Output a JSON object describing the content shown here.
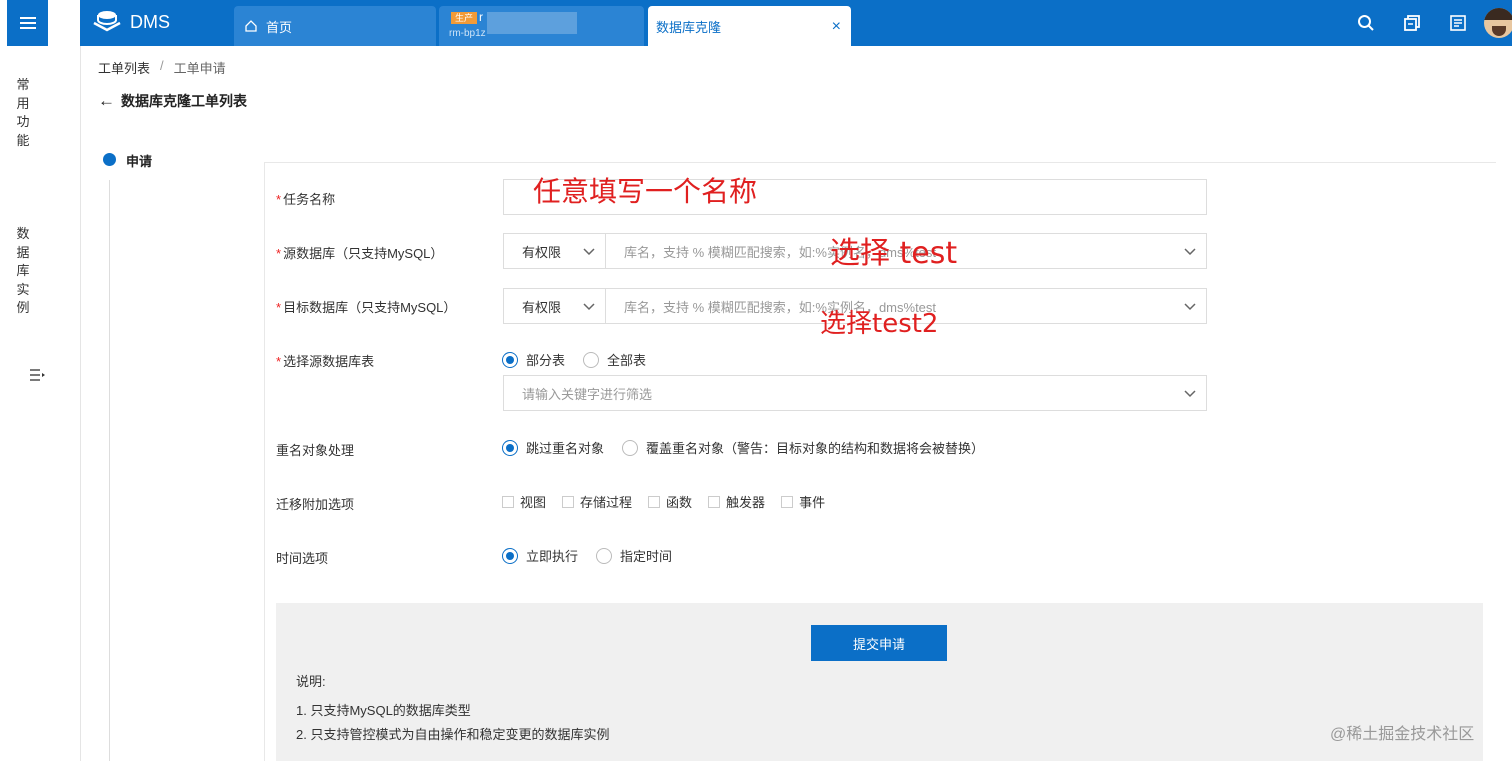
{
  "topbar": {
    "brand": "DMS",
    "tabs": [
      {
        "label": "首页"
      },
      {
        "env": "生产",
        "title": "r",
        "sub": "rm-bp1z"
      },
      {
        "label": "数据库克隆",
        "close": "×"
      }
    ]
  },
  "rail": {
    "common": "常用功能",
    "instances": "数据库实例"
  },
  "breadcrumb": {
    "first": "工单列表",
    "sep": "/",
    "current": "工单申请"
  },
  "back_label": "数据库克隆工单列表",
  "step": {
    "label": "申请"
  },
  "form": {
    "task_name": {
      "label": "任务名称",
      "value": ""
    },
    "source_db": {
      "label": "源数据库（只支持MySQL）",
      "perm": "有权限",
      "placeholder": "库名，支持 % 模糊匹配搜索，如:%实例名，dms%test"
    },
    "target_db": {
      "label": "目标数据库（只支持MySQL）",
      "perm": "有权限",
      "placeholder": "库名，支持 % 模糊匹配搜索，如:%实例名，dms%test"
    },
    "source_tables": {
      "label": "选择源数据库表",
      "options": [
        "部分表",
        "全部表"
      ],
      "selected": "部分表",
      "filter_placeholder": "请输入关键字进行筛选"
    },
    "rename": {
      "label": "重名对象处理",
      "options": [
        "跳过重名对象",
        "覆盖重名对象（警告：目标对象的结构和数据将会被替换）"
      ],
      "selected": "跳过重名对象"
    },
    "extras": {
      "label": "迁移附加选项",
      "options": [
        "视图",
        "存储过程",
        "函数",
        "触发器",
        "事件"
      ]
    },
    "time": {
      "label": "时间选项",
      "options": [
        "立即执行",
        "指定时间"
      ],
      "selected": "立即执行"
    }
  },
  "submit": {
    "button": "提交申请",
    "note_title": "说明:",
    "notes": [
      "1. 只支持MySQL的数据库类型",
      "2. 只支持管控模式为自由操作和稳定变更的数据库实例"
    ]
  },
  "annotations": {
    "name_hint": "任意填写一个名称",
    "source_hint": "选择 test",
    "target_hint": "选择test2"
  },
  "watermark": "@稀土掘金技术社区",
  "colors": {
    "primary": "#0b6fc7",
    "annotation": "#e02020",
    "env_badge": "#f29b38"
  }
}
